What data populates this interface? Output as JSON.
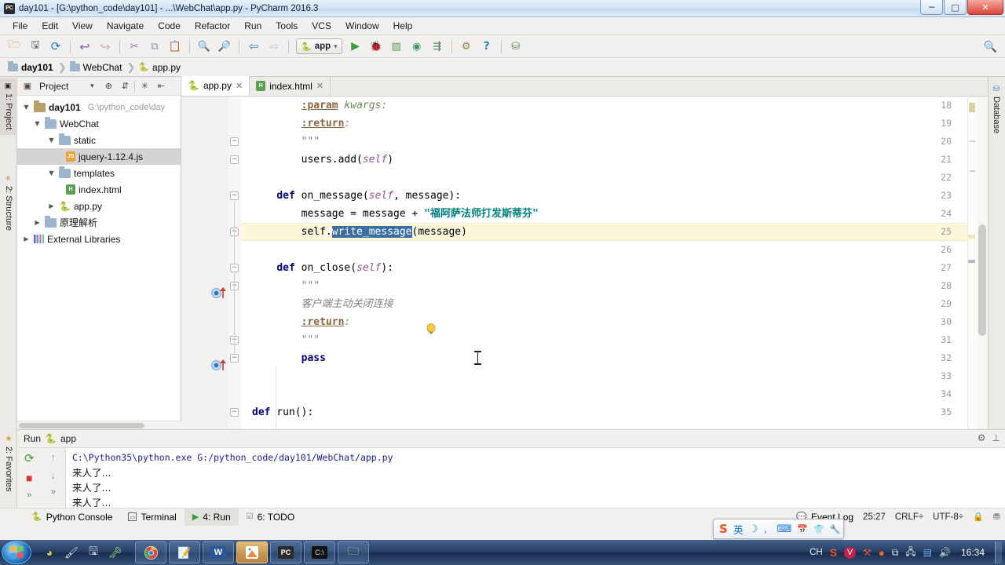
{
  "window": {
    "title": "day101 - [G:\\python_code\\day101] - ...\\WebChat\\app.py - PyCharm 2016.3",
    "app_icon": "pycharm-icon",
    "minimize": "─",
    "maximize": "□",
    "close": "✕"
  },
  "menubar": {
    "items": [
      {
        "label": "File"
      },
      {
        "label": "Edit"
      },
      {
        "label": "View"
      },
      {
        "label": "Navigate"
      },
      {
        "label": "Code"
      },
      {
        "label": "Refactor"
      },
      {
        "label": "Run"
      },
      {
        "label": "Tools"
      },
      {
        "label": "VCS"
      },
      {
        "label": "Window"
      },
      {
        "label": "Help"
      }
    ]
  },
  "toolbar": {
    "icons": [
      {
        "name": "open-folder-icon",
        "glyph": "🗁"
      },
      {
        "name": "save-all-icon",
        "glyph": "🖫"
      },
      {
        "name": "sync-icon",
        "glyph": "⟳"
      },
      {
        "name": "undo-icon",
        "glyph": "↩"
      },
      {
        "name": "redo-icon",
        "glyph": "↪"
      },
      {
        "name": "cut-icon",
        "glyph": "✂"
      },
      {
        "name": "copy-icon",
        "glyph": "⧉"
      },
      {
        "name": "paste-icon",
        "glyph": "📋"
      },
      {
        "name": "find-icon",
        "glyph": "🔍"
      },
      {
        "name": "replace-icon",
        "glyph": "🔎"
      },
      {
        "name": "back-icon",
        "glyph": "⇦"
      },
      {
        "name": "forward-icon",
        "glyph": "⇨"
      }
    ],
    "run_config": {
      "name": "app",
      "icon": "python-config-icon",
      "dropdown": "▾"
    },
    "run_icons": [
      {
        "name": "run-button",
        "glyph": "▶"
      },
      {
        "name": "debug-button",
        "glyph": "🐞"
      },
      {
        "name": "coverage-button",
        "glyph": "▨"
      },
      {
        "name": "profile-button",
        "glyph": "◉"
      },
      {
        "name": "attach-button",
        "glyph": "⇶"
      }
    ],
    "right_icons": [
      {
        "name": "settings-icon",
        "glyph": "⚙"
      },
      {
        "name": "help-icon",
        "glyph": "?"
      },
      {
        "name": "project-structure-icon",
        "glyph": "⛁"
      }
    ],
    "search_icon": "🔍"
  },
  "breadcrumb": {
    "items": [
      {
        "label": "day101",
        "icon": "folder-icon"
      },
      {
        "label": "WebChat",
        "icon": "folder-icon"
      },
      {
        "label": "app.py",
        "icon": "python-file-icon"
      }
    ],
    "separator": "❯"
  },
  "left_sidebar": {
    "tabs": [
      {
        "label": "1: Project",
        "icon": "project-icon",
        "selected": true
      },
      {
        "label": "2: Structure",
        "icon": "structure-icon",
        "selected": false
      }
    ],
    "bottom_tabs": [
      {
        "label": "2: Favorites",
        "icon": "star-icon"
      }
    ]
  },
  "right_sidebar": {
    "tabs": [
      {
        "label": "Database",
        "icon": "database-icon"
      }
    ]
  },
  "project_panel": {
    "title": "Project",
    "header_icons": [
      {
        "name": "project-view-icon",
        "glyph": "▣"
      },
      {
        "name": "chevron-down-icon",
        "glyph": "▾"
      },
      {
        "name": "target-icon",
        "glyph": "⊕"
      },
      {
        "name": "collapse-all-icon",
        "glyph": "⇵"
      },
      {
        "name": "gear-icon",
        "glyph": "✳"
      },
      {
        "name": "hide-icon",
        "glyph": "⇤"
      }
    ],
    "tree": [
      {
        "label": "day101",
        "path": "G:\\python_code\\day",
        "twisty": "▼",
        "icon": "folder-plain-icon",
        "depth": 0,
        "bold": true,
        "selected": false
      },
      {
        "label": "WebChat",
        "path": "",
        "twisty": "▼",
        "icon": "folder-blue-icon",
        "depth": 1,
        "bold": false,
        "selected": false
      },
      {
        "label": "static",
        "path": "",
        "twisty": "▼",
        "icon": "folder-blue-icon",
        "depth": 2,
        "bold": false,
        "selected": false
      },
      {
        "label": "jquery-1.12.4.js",
        "path": "",
        "twisty": "",
        "icon": "js-file-icon",
        "depth": 3,
        "bold": false,
        "selected": true
      },
      {
        "label": "templates",
        "path": "",
        "twisty": "▼",
        "icon": "folder-blue-icon",
        "depth": 2,
        "bold": false,
        "selected": false
      },
      {
        "label": "index.html",
        "path": "",
        "twisty": "",
        "icon": "html-file-icon",
        "depth": 3,
        "bold": false,
        "selected": false
      },
      {
        "label": "app.py",
        "path": "",
        "twisty": "▶",
        "icon": "python-file-icon",
        "depth": 2,
        "bold": false,
        "selected": false
      },
      {
        "label": "原理解析",
        "path": "",
        "twisty": "▶",
        "icon": "folder-blue-icon",
        "depth": 1,
        "bold": false,
        "selected": false
      },
      {
        "label": "External Libraries",
        "path": "",
        "twisty": "▶",
        "icon": "libraries-icon",
        "depth": 0,
        "bold": false,
        "selected": false
      }
    ]
  },
  "editor": {
    "tabs": [
      {
        "label": "app.py",
        "icon": "python-file-icon",
        "active": true,
        "close": "✕"
      },
      {
        "label": "index.html",
        "icon": "html-file-icon",
        "active": false,
        "close": "✕"
      }
    ],
    "first_line_number": 18,
    "lines": [
      {
        "num": 18,
        "segs": [
          {
            "t": "        ",
            "c": "plain"
          },
          {
            "t": ":param",
            "c": "docparam"
          },
          {
            "t": " ",
            "c": "plain"
          },
          {
            "t": "kwargs",
            "c": "docital"
          },
          {
            "t": ":",
            "c": "cmt"
          }
        ]
      },
      {
        "num": 19,
        "segs": [
          {
            "t": "        ",
            "c": "plain"
          },
          {
            "t": ":return",
            "c": "docparam"
          },
          {
            "t": ":",
            "c": "cmt"
          }
        ]
      },
      {
        "num": 20,
        "segs": [
          {
            "t": "        ",
            "c": "plain"
          },
          {
            "t": "\"\"\"",
            "c": "cmt"
          }
        ]
      },
      {
        "num": 21,
        "segs": [
          {
            "t": "        users.add(",
            "c": "plain"
          },
          {
            "t": "self",
            "c": "self-kw"
          },
          {
            "t": ")",
            "c": "plain"
          }
        ]
      },
      {
        "num": 22,
        "segs": []
      },
      {
        "num": 23,
        "segs": [
          {
            "t": "    ",
            "c": "plain"
          },
          {
            "t": "def",
            "c": "kw"
          },
          {
            "t": " on_message(",
            "c": "plain"
          },
          {
            "t": "self",
            "c": "self-kw"
          },
          {
            "t": ", message):",
            "c": "plain"
          }
        ]
      },
      {
        "num": 24,
        "segs": [
          {
            "t": "        message = message + ",
            "c": "plain"
          },
          {
            "t": "\"福阿萨法师打发斯蒂芬\"",
            "c": "str"
          }
        ]
      },
      {
        "num": 25,
        "segs": [
          {
            "t": "        self.",
            "c": "plain"
          },
          {
            "t": "write_message",
            "c": "sel-tok"
          },
          {
            "t": "(message)",
            "c": "plain"
          }
        ]
      },
      {
        "num": 26,
        "segs": []
      },
      {
        "num": 27,
        "segs": [
          {
            "t": "    ",
            "c": "plain"
          },
          {
            "t": "def",
            "c": "kw"
          },
          {
            "t": " on_close(",
            "c": "plain"
          },
          {
            "t": "self",
            "c": "self-kw"
          },
          {
            "t": "):",
            "c": "plain"
          }
        ]
      },
      {
        "num": 28,
        "segs": [
          {
            "t": "        ",
            "c": "plain"
          },
          {
            "t": "\"\"\"",
            "c": "cmt"
          }
        ]
      },
      {
        "num": 29,
        "segs": [
          {
            "t": "        ",
            "c": "plain"
          },
          {
            "t": "客户端主动关闭连接",
            "c": "cmt"
          }
        ]
      },
      {
        "num": 30,
        "segs": [
          {
            "t": "        ",
            "c": "plain"
          },
          {
            "t": ":return",
            "c": "docparam"
          },
          {
            "t": ":",
            "c": "cmt"
          }
        ]
      },
      {
        "num": 31,
        "segs": [
          {
            "t": "        ",
            "c": "plain"
          },
          {
            "t": "\"\"\"",
            "c": "cmt"
          }
        ]
      },
      {
        "num": 32,
        "segs": [
          {
            "t": "        ",
            "c": "plain"
          },
          {
            "t": "pass",
            "c": "kw"
          }
        ]
      },
      {
        "num": 33,
        "segs": []
      },
      {
        "num": 34,
        "segs": []
      },
      {
        "num": 35,
        "segs": [
          {
            "t": "",
            "c": "plain"
          },
          {
            "t": "def",
            "c": "kw"
          },
          {
            "t": " run():",
            "c": "plain"
          }
        ]
      }
    ],
    "highlighted_line": 25,
    "selected_token": "write_message",
    "gutter_markers": [
      {
        "line": 23,
        "name": "override-method-icon"
      },
      {
        "line": 27,
        "name": "override-method-icon"
      },
      {
        "line": 25,
        "name": "intention-bulb-icon"
      }
    ]
  },
  "run_panel": {
    "title": "Run",
    "config_name": "app",
    "icon": "python-run-icon",
    "side_buttons": [
      {
        "name": "rerun-button",
        "glyph": "⟳"
      },
      {
        "name": "stop-button",
        "glyph": "■"
      },
      {
        "name": "more-button",
        "glyph": "»"
      },
      {
        "name": "scroll-up-button",
        "glyph": "↑"
      },
      {
        "name": "scroll-down-button",
        "glyph": "↓"
      },
      {
        "name": "more2-button",
        "glyph": "»"
      }
    ],
    "header_right": [
      {
        "name": "settings-icon",
        "glyph": "⚙"
      },
      {
        "name": "hide-icon",
        "glyph": "⊥"
      }
    ],
    "console": [
      {
        "text": "C:\\Python35\\python.exe G:/python_code/day101/WebChat/app.py",
        "kind": "cmd"
      },
      {
        "text": "来人了...",
        "kind": "cn"
      },
      {
        "text": "来人了...",
        "kind": "cn"
      },
      {
        "text": "来人了...",
        "kind": "cn"
      }
    ]
  },
  "statusbar": {
    "tools": [
      {
        "label": "Python Console",
        "icon": "python-icon",
        "selected": false
      },
      {
        "label": "Terminal",
        "icon": "terminal-icon",
        "selected": false
      },
      {
        "label": "4: Run",
        "icon": "run-icon",
        "selected": true
      },
      {
        "label": "6: TODO",
        "icon": "todo-icon",
        "selected": false
      }
    ],
    "event_log": {
      "label": "Event Log",
      "icon": "balloon-icon"
    },
    "caret_position": "25:27",
    "line_separator": "CRLF÷",
    "encoding": "UTF-8÷",
    "lock_icon": "🔒",
    "hector_icon": "⛃"
  },
  "ime_bar": {
    "logo": "S",
    "items": [
      {
        "name": "language-mode-icon",
        "glyph": "英"
      },
      {
        "name": "moon-icon",
        "glyph": "☽"
      },
      {
        "name": "punctuation-icon",
        "glyph": "，"
      },
      {
        "name": "soft-keyboard-icon",
        "glyph": "⌨"
      },
      {
        "name": "calendar-icon",
        "glyph": "📅"
      },
      {
        "name": "skin-icon",
        "glyph": "👕"
      },
      {
        "name": "toolbox-icon",
        "glyph": "🔧"
      }
    ]
  },
  "taskbar": {
    "start": "start-orb",
    "quick_launch": [
      {
        "name": "media-player-icon",
        "glyph": "◕"
      },
      {
        "name": "paint-icon",
        "glyph": "🖌"
      },
      {
        "name": "save-icon",
        "glyph": "🖫"
      },
      {
        "name": "key-icon",
        "glyph": "🗝"
      }
    ],
    "apps": [
      {
        "name": "chrome-taskbar-button",
        "glyph": "◉",
        "active": false
      },
      {
        "name": "notepad-taskbar-button",
        "glyph": "📝",
        "active": false
      },
      {
        "name": "word-taskbar-button",
        "glyph": "W",
        "active": false
      },
      {
        "name": "screenshot-taskbar-button",
        "glyph": "▲",
        "active": true
      },
      {
        "name": "pycharm-taskbar-button",
        "glyph": "PC",
        "active": false
      },
      {
        "name": "cmd-taskbar-button",
        "glyph": "⌨",
        "active": false
      },
      {
        "name": "explorer-taskbar-button",
        "glyph": "🗀",
        "active": false
      }
    ],
    "tray": [
      {
        "name": "language-indicator",
        "glyph": "CH"
      },
      {
        "name": "sogou-tray-icon",
        "glyph": "S"
      },
      {
        "name": "antivirus-tray-icon",
        "glyph": "V"
      },
      {
        "name": "tools-tray-icon",
        "glyph": "⚒"
      },
      {
        "name": "orange-tray-icon",
        "glyph": "●"
      },
      {
        "name": "windows-tray-icon",
        "glyph": "⧉"
      },
      {
        "name": "network-tray-icon",
        "glyph": "🖧"
      },
      {
        "name": "display-tray-icon",
        "glyph": "▤"
      },
      {
        "name": "volume-tray-icon",
        "glyph": "🔊"
      }
    ],
    "clock": "16:34"
  },
  "colors": {
    "accent": "#3a6ea5",
    "highlight_row": "#fdf6dd",
    "string_green": "#008080",
    "keyword_navy": "#000080",
    "selection_blue": "#3a6ea5"
  }
}
